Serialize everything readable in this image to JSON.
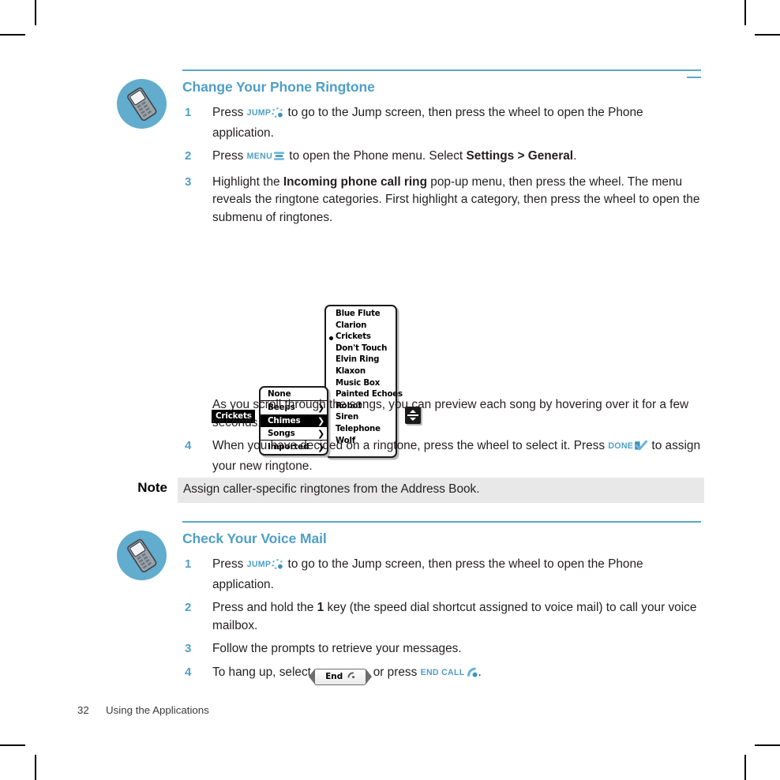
{
  "document": {
    "footer_page_number": "32",
    "footer_title": "Using the Applications"
  },
  "sections": [
    {
      "id": "ringtone",
      "icon_name": "phone-app-icon",
      "heading": "Change Your Phone Ringtone",
      "steps": [
        {
          "number": "1",
          "parts": [
            {
              "t": "text",
              "v": "Press "
            },
            {
              "t": "key",
              "v": "JUMP",
              "icon": "jump-wheel-icon"
            },
            {
              "t": "text",
              "v": " to go to the Jump screen, then press the wheel to open the Phone application."
            }
          ]
        },
        {
          "number": "2",
          "parts": [
            {
              "t": "text",
              "v": "Press "
            },
            {
              "t": "key",
              "v": "MENU",
              "icon": "menu-bars-icon"
            },
            {
              "t": "text",
              "v": " to open the Phone menu. Select "
            },
            {
              "t": "bold",
              "v": "Settings > General"
            },
            {
              "t": "text",
              "v": "."
            }
          ]
        },
        {
          "number": "3",
          "parts": [
            {
              "t": "text",
              "v": "Highlight the "
            },
            {
              "t": "bold",
              "v": "Incoming phone call ring"
            },
            {
              "t": "text",
              "v": " pop-up menu, then press the wheel. The menu reveals the ringtone categories. First highlight a category, then press the wheel to open the submenu of ringtones."
            }
          ]
        },
        {
          "number": "",
          "parts": [
            {
              "t": "text",
              "v": "As you scroll through the songs, you can preview each song by hovering over it for a few seconds."
            }
          ]
        },
        {
          "number": "4",
          "parts": [
            {
              "t": "text",
              "v": "When you have decided on a ringtone, press the wheel to select it. Press "
            },
            {
              "t": "key",
              "v": "DONE",
              "icon": "done-check-icon"
            },
            {
              "t": "text",
              "v": " to assign your new ringtone."
            }
          ]
        }
      ]
    },
    {
      "id": "voicemail",
      "icon_name": "phone-app-icon",
      "heading": "Check Your Voice Mail",
      "steps": [
        {
          "number": "1",
          "parts": [
            {
              "t": "text",
              "v": "Press "
            },
            {
              "t": "key",
              "v": "JUMP",
              "icon": "jump-wheel-icon"
            },
            {
              "t": "text",
              "v": " to go to the Jump screen, then press the wheel to open the Phone application."
            }
          ]
        },
        {
          "number": "2",
          "parts": [
            {
              "t": "text",
              "v": "Press and hold the "
            },
            {
              "t": "bold",
              "v": "1"
            },
            {
              "t": "text",
              "v": " key (the speed dial shortcut assigned to voice mail) to call your voice mailbox."
            }
          ]
        },
        {
          "number": "3",
          "parts": [
            {
              "t": "text",
              "v": "Follow the prompts to retrieve your messages."
            }
          ]
        },
        {
          "number": "4",
          "parts": [
            {
              "t": "text",
              "v": "To hang up, select "
            },
            {
              "t": "endbutton",
              "v": "End",
              "icon": "phone-handset-icon"
            },
            {
              "t": "text",
              "v": ", or press "
            },
            {
              "t": "key",
              "v": "END CALL",
              "icon": "end-call-icon"
            },
            {
              "t": "text",
              "v": "."
            }
          ]
        }
      ]
    }
  ],
  "note": {
    "label": "Note",
    "text": "Assign caller-specific ringtones from the Address Book."
  },
  "figure": {
    "name": "ringtone-menu-screenshot",
    "current_value": "Crickets",
    "categories": [
      {
        "label": "None",
        "has_arrow": false,
        "selected": false,
        "separator_after": true
      },
      {
        "label": "Beeps",
        "has_arrow": true,
        "selected": false,
        "separator_after": false
      },
      {
        "label": "Chimes",
        "has_arrow": true,
        "selected": true,
        "separator_after": false
      },
      {
        "label": "Songs",
        "has_arrow": true,
        "selected": false,
        "separator_after": true
      },
      {
        "label": "Imported",
        "has_arrow": true,
        "selected": false,
        "separator_after": false
      }
    ],
    "ringtones": [
      {
        "label": "Blue Flute",
        "checked": false
      },
      {
        "label": "Clarion",
        "checked": false
      },
      {
        "label": "Crickets",
        "checked": true
      },
      {
        "label": "Don't Touch",
        "checked": false
      },
      {
        "label": "Elvin Ring",
        "checked": false
      },
      {
        "label": "Klaxon",
        "checked": false
      },
      {
        "label": "Music Box",
        "checked": false
      },
      {
        "label": "Painted Echoes",
        "checked": false
      },
      {
        "label": "Robot",
        "checked": false
      },
      {
        "label": "Siren",
        "checked": false
      },
      {
        "label": "Telephone",
        "checked": false
      },
      {
        "label": "Wolf",
        "checked": false
      }
    ],
    "scroll_indicator": "scroll-up-down-icon",
    "arrow_glyph": "❯"
  },
  "colors": {
    "accent_blue": "#4f9fc6",
    "rule_blue": "#5ba7cd",
    "note_bg": "#e8e8e8",
    "body_text": "#231f20"
  }
}
